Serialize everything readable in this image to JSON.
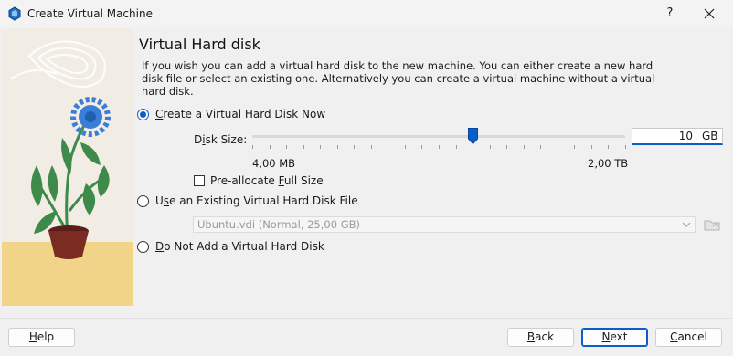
{
  "window": {
    "title": "Create Virtual Machine",
    "help_glyph": "?"
  },
  "page": {
    "heading": "Virtual Hard disk",
    "description": "If you wish you can add a virtual hard disk to the new machine. You can either create a new hard disk file or select an existing one. Alternatively you can create a virtual machine without a virtual hard disk."
  },
  "options": {
    "create_new": {
      "label_pre": "",
      "mnemonic": "C",
      "label_post": "reate a Virtual Hard Disk Now",
      "selected": true
    },
    "use_existing": {
      "label_pre": "U",
      "mnemonic": "s",
      "label_post": "e an Existing Virtual Hard Disk File",
      "selected": false
    },
    "do_not_add": {
      "label_pre": "",
      "mnemonic": "D",
      "label_post": "o Not Add a Virtual Hard Disk",
      "selected": false
    }
  },
  "disk_size": {
    "label_pre": "D",
    "mnemonic": "i",
    "label_post": "sk Size:",
    "value": "10",
    "unit": "GB",
    "min_label": "4,00 MB",
    "max_label": "2,00 TB",
    "slider_position_fraction": 0.59
  },
  "preallocate": {
    "label_pre": "Pre-allocate ",
    "mnemonic": "F",
    "label_post": "ull Size",
    "checked": false
  },
  "existing_file": {
    "selected_value": "Ubuntu.vdi (Normal, 25,00 GB)"
  },
  "buttons": {
    "help": {
      "mnemonic": "H",
      "rest": "elp"
    },
    "back": {
      "mnemonic": "B",
      "rest": "ack"
    },
    "next": {
      "mnemonic": "N",
      "rest": "ext"
    },
    "cancel": {
      "pre": "",
      "mnemonic": "C",
      "rest": "ancel"
    }
  },
  "colors": {
    "accent": "#0a5ec7",
    "flower": "#3b7ed8",
    "leaf": "#3e8a4a",
    "pot": "#7a2b22",
    "ground": "#f1d487"
  }
}
